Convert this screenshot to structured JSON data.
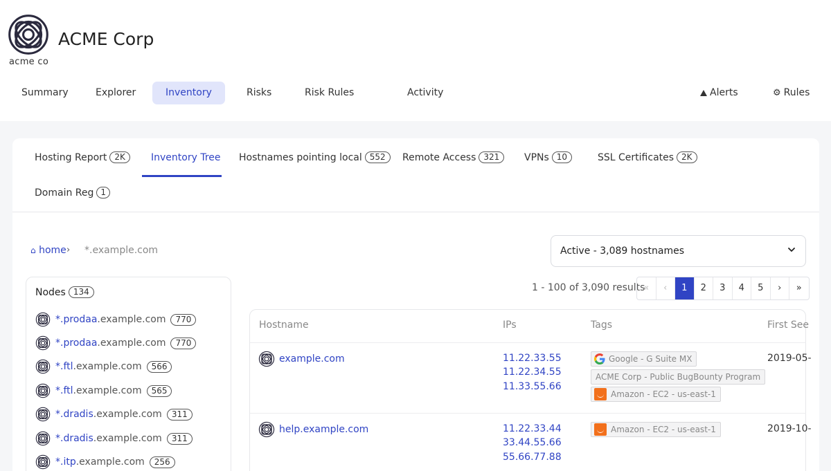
{
  "brand": {
    "name": "ACME Corp",
    "logo_text": "acme co",
    "logo_color": "#2b2a3e"
  },
  "nav": {
    "items": [
      {
        "label": "Summary"
      },
      {
        "label": "Explorer"
      },
      {
        "label": "Inventory",
        "active": true
      },
      {
        "label": "Risks"
      },
      {
        "label": "Risk Rules"
      },
      {
        "label": "Activity"
      }
    ],
    "alerts": {
      "label": "Alerts",
      "icon": "warning-triangle-icon"
    },
    "rules": {
      "label": "Rules",
      "icon": "gear-icon"
    }
  },
  "tabs": [
    {
      "label": "Hosting Report",
      "count": "2K"
    },
    {
      "label": "Inventory Tree",
      "active": true
    },
    {
      "label": "Hostnames pointing local",
      "count": "552"
    },
    {
      "label": "Remote Access",
      "count": "321"
    },
    {
      "label": "VPNs",
      "count": "10"
    },
    {
      "label": "SSL Certificates",
      "count": "2K"
    },
    {
      "label": "Domain Reg",
      "count": "1"
    }
  ],
  "breadcrumb": {
    "home": "home",
    "current": "*.example.com"
  },
  "status_select": {
    "value": "Active - 3,089 hostnames"
  },
  "nodes": {
    "title": "Nodes",
    "count": "134",
    "items": [
      {
        "prefix": "*.",
        "link": "prodaa",
        "suffix": ".example.com",
        "count": "770"
      },
      {
        "prefix": "*.",
        "link": "prodaa",
        "suffix": ".example.com",
        "count": "770"
      },
      {
        "prefix": "*.",
        "link": "ftl",
        "suffix": ".example.com",
        "count": "566"
      },
      {
        "prefix": "*.",
        "link": "ftl",
        "suffix": ".example.com",
        "count": "565"
      },
      {
        "prefix": "*.",
        "link": "dradis",
        "suffix": ".example.com",
        "count": "311"
      },
      {
        "prefix": "*.",
        "link": "dradis",
        "suffix": ".example.com",
        "count": "311"
      },
      {
        "prefix": "*.",
        "link": "itp",
        "suffix": ".example.com",
        "count": "256"
      }
    ]
  },
  "pagination": {
    "results_text": "1 - 100 of 3,090 results",
    "first": "«",
    "prev": "‹",
    "pages": [
      "1",
      "2",
      "3",
      "4",
      "5"
    ],
    "current_page": "1",
    "next": "›",
    "last": "»"
  },
  "table": {
    "headers": {
      "hostname": "Hostname",
      "ips": "IPs",
      "tags": "Tags",
      "first_seen": "First See"
    },
    "rows": [
      {
        "hostname": "example.com",
        "ips": [
          "11.22.33.55",
          "11.22.34.55",
          "11.33.55.66"
        ],
        "tags": [
          {
            "icon": "google-icon",
            "label": "Google - G Suite MX"
          },
          {
            "icon": "",
            "label": "ACME Corp - Public BugBounty Program"
          },
          {
            "icon": "amazon-icon",
            "label": "Amazon - EC2 - us-east-1"
          }
        ],
        "first_seen": "2019-05-"
      },
      {
        "hostname": "help.example.com",
        "ips": [
          "11.22.33.44",
          "33.44.55.66",
          "55.66.77.88"
        ],
        "tags": [
          {
            "icon": "amazon-icon",
            "label": "Amazon - EC2 - us-east-1"
          }
        ],
        "first_seen": "2019-10-"
      }
    ]
  },
  "colors": {
    "accent": "#3044c4",
    "nav_active_bg": "#e1e5fb",
    "amazon": "#f2701c"
  }
}
